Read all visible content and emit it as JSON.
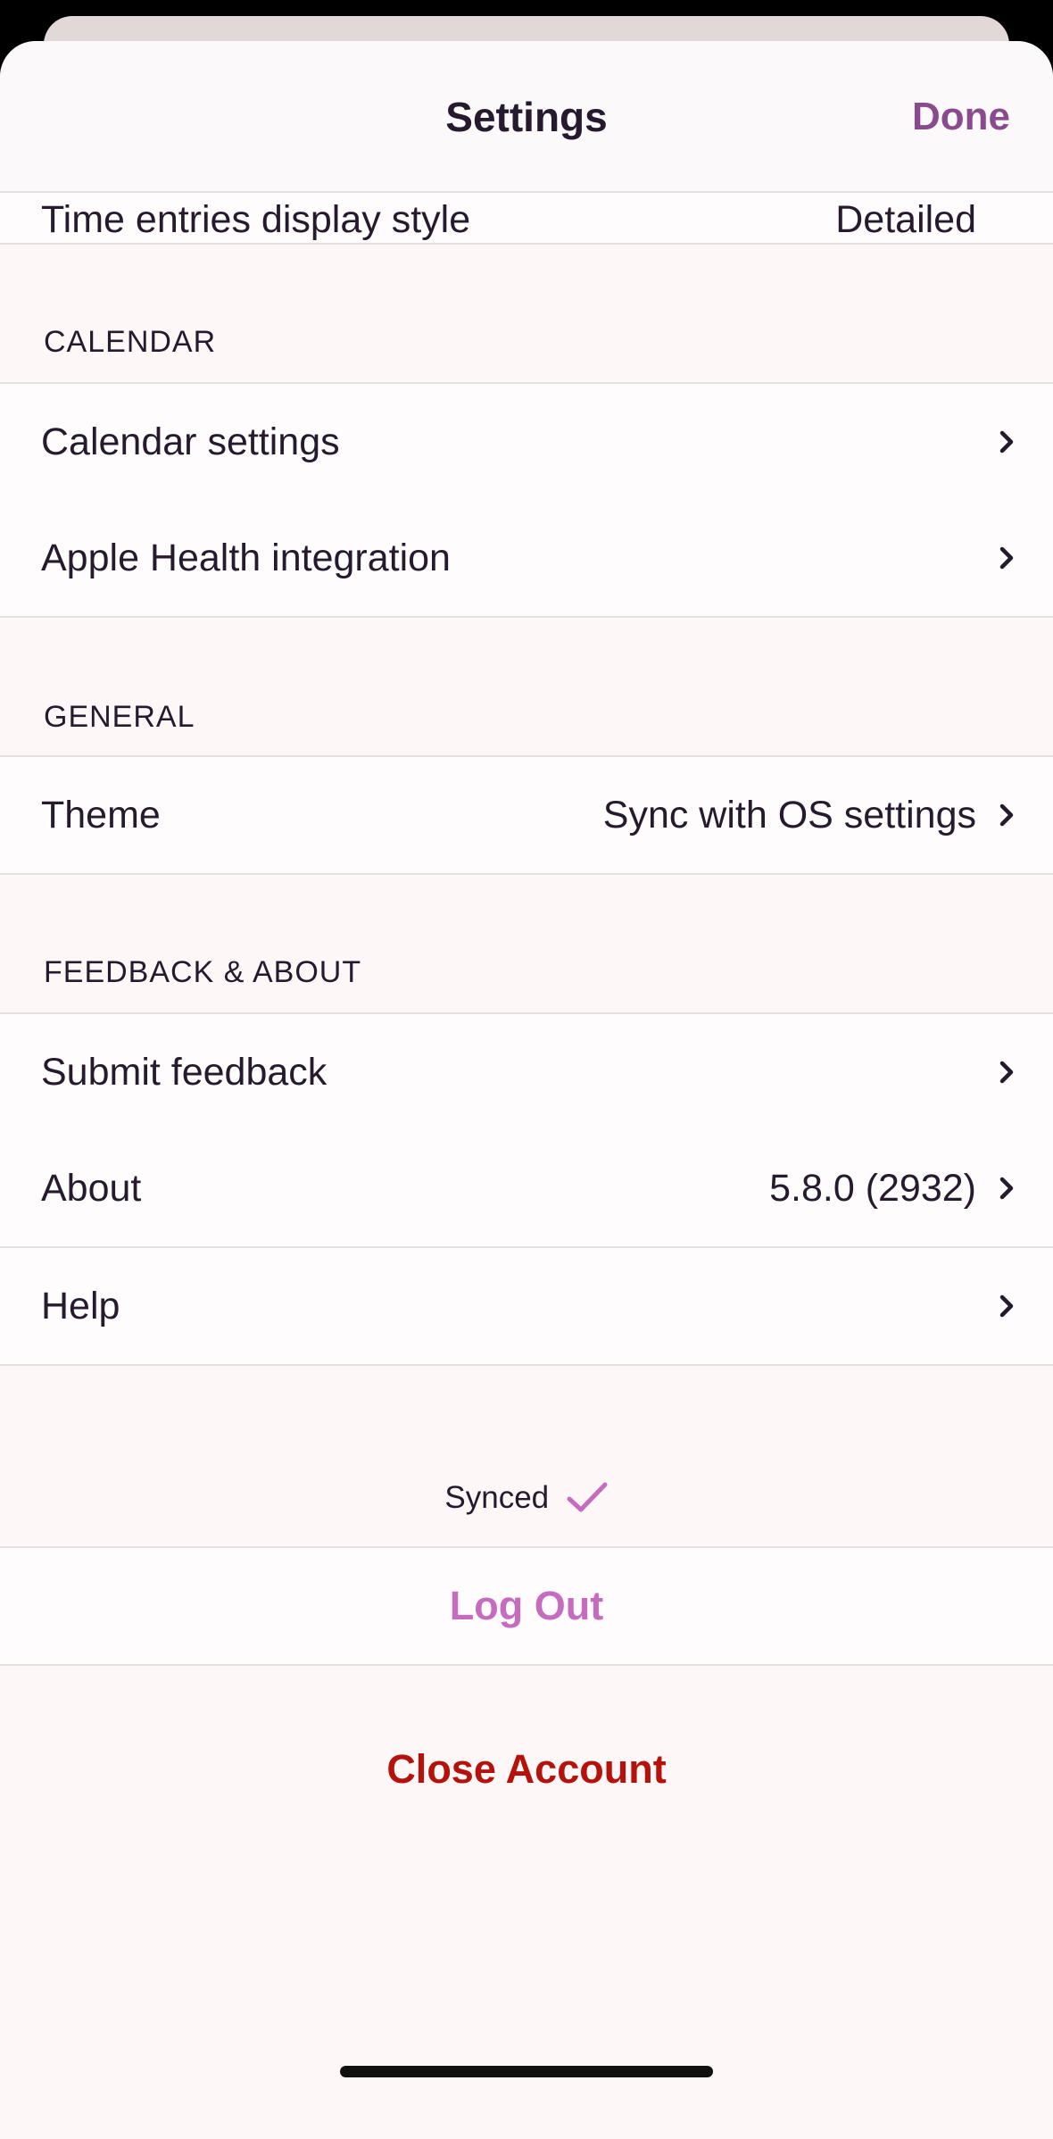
{
  "header": {
    "title": "Settings",
    "done_label": "Done"
  },
  "partial_row": {
    "label": "Time entries display style",
    "value": "Detailed"
  },
  "sections": {
    "calendar": {
      "header": "CALENDAR",
      "items": [
        {
          "label": "Calendar settings",
          "value": ""
        },
        {
          "label": "Apple Health integration",
          "value": ""
        }
      ]
    },
    "general": {
      "header": "GENERAL",
      "items": [
        {
          "label": "Theme",
          "value": "Sync with OS settings"
        }
      ]
    },
    "feedback": {
      "header": "FEEDBACK & ABOUT",
      "items": [
        {
          "label": "Submit feedback",
          "value": ""
        },
        {
          "label": "About",
          "value": "5.8.0 (2932)"
        },
        {
          "label": "Help",
          "value": ""
        }
      ]
    }
  },
  "sync": {
    "status": "Synced",
    "icon": "checkmark-icon"
  },
  "actions": {
    "logout_label": "Log Out",
    "close_account_label": "Close Account"
  },
  "colors": {
    "accent": "#8a4b8e",
    "logout": "#c66cc0",
    "danger": "#b5120c",
    "text": "#261a2e",
    "background": "#fdf7f7"
  }
}
